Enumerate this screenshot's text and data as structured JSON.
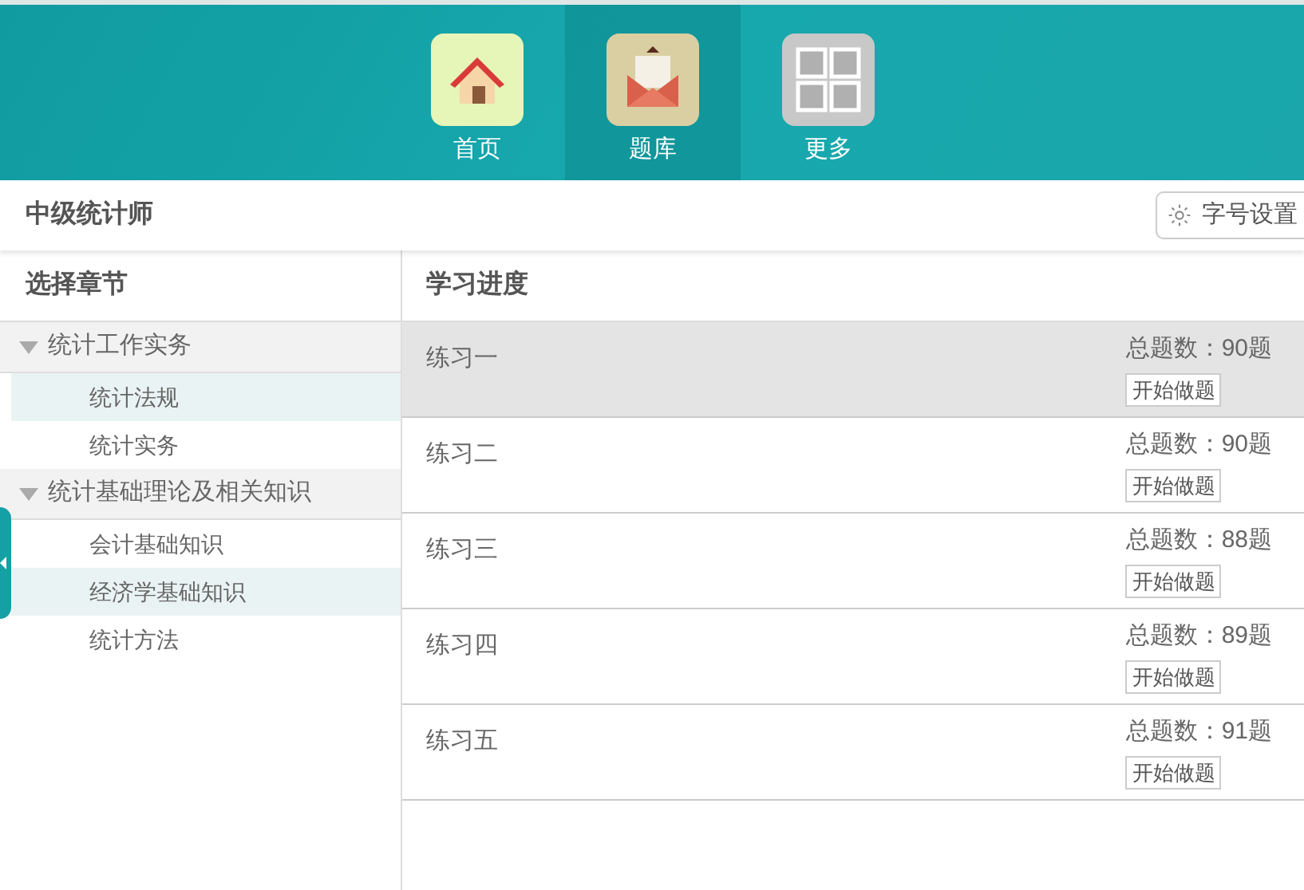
{
  "nav": [
    {
      "label": "首页",
      "kind": "home",
      "selected": false
    },
    {
      "label": "题库",
      "kind": "bank",
      "selected": true
    },
    {
      "label": "更多",
      "kind": "more",
      "selected": false
    }
  ],
  "title": "中级统计师",
  "font_button": "字号设置",
  "sidebar": {
    "heading": "选择章节",
    "groups": [
      {
        "label": "统计工作实务",
        "expanded": true,
        "children": [
          {
            "label": "统计法规",
            "selected": true
          },
          {
            "label": "统计实务",
            "selected": false
          }
        ]
      },
      {
        "label": "统计基础理论及相关知识",
        "expanded": true,
        "children": [
          {
            "label": "会计基础知识",
            "selected": false
          },
          {
            "label": "经济学基础知识",
            "selected": true
          },
          {
            "label": "统计方法",
            "selected": false
          }
        ]
      }
    ]
  },
  "progress": {
    "heading": "学习进度",
    "rows": [
      {
        "name": "练习一",
        "total": "总题数：90题",
        "action": "开始做题",
        "selected": true
      },
      {
        "name": "练习二",
        "total": "总题数：90题",
        "action": "开始做题",
        "selected": false
      },
      {
        "name": "练习三",
        "total": "总题数：88题",
        "action": "开始做题",
        "selected": false
      },
      {
        "name": "练习四",
        "total": "总题数：89题",
        "action": "开始做题",
        "selected": false
      },
      {
        "name": "练习五",
        "total": "总题数：91题",
        "action": "开始做题",
        "selected": false
      }
    ]
  }
}
